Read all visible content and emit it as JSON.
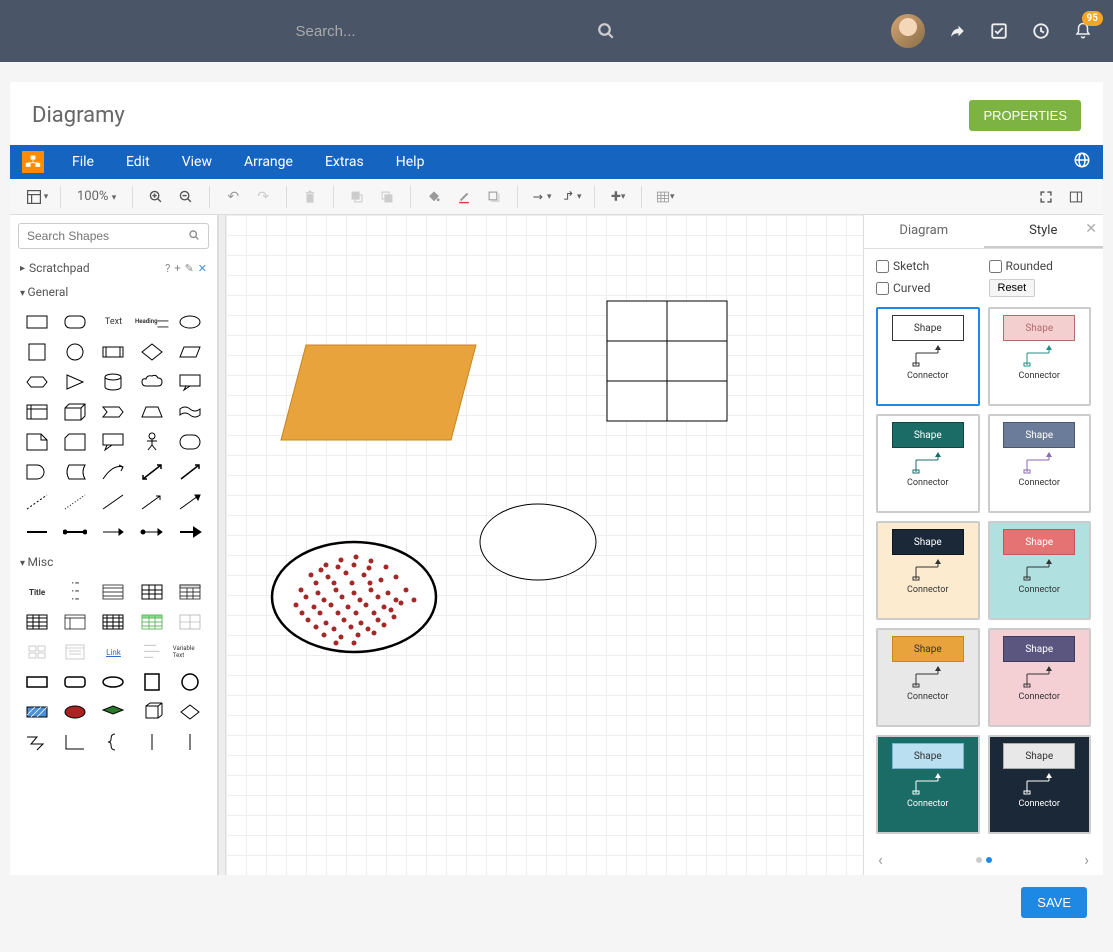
{
  "topbar": {
    "search_placeholder": "Search...",
    "badge": "95"
  },
  "app": {
    "title": "Diagramy",
    "properties_btn": "PROPERTIES",
    "save_btn": "SAVE"
  },
  "menu": {
    "file": "File",
    "edit": "Edit",
    "view": "View",
    "arrange": "Arrange",
    "extras": "Extras",
    "help": "Help"
  },
  "toolbar": {
    "zoom": "100%"
  },
  "left": {
    "search_placeholder": "Search Shapes",
    "scratchpad": "Scratchpad",
    "general": "General",
    "misc": "Misc",
    "text_cell": "Text",
    "title_cell": "Title",
    "link_cell": "Link",
    "variable_cell": "Variable Text",
    "heading_cell": "Heading"
  },
  "right": {
    "tab_diagram": "Diagram",
    "tab_style": "Style",
    "sketch": "Sketch",
    "curved": "Curved",
    "rounded": "Rounded",
    "reset": "Reset",
    "shape_label": "Shape",
    "connector_label": "Connector"
  },
  "style_cards": [
    {
      "bg": "#ffffff",
      "shape_fill": "#ffffff",
      "shape_border": "#333",
      "text": "#333",
      "conn": "#333",
      "border": "#1e88e5"
    },
    {
      "bg": "#ffffff",
      "shape_fill": "#f4cfcf",
      "shape_border": "#b56b6b",
      "text": "#b56b6b",
      "conn": "#2a8b8b",
      "border": "#ccc"
    },
    {
      "bg": "#ffffff",
      "shape_fill": "#1b6b67",
      "shape_border": "#0d4643",
      "text": "#fff",
      "conn": "#1b6b67",
      "border": "#ccc"
    },
    {
      "bg": "#ffffff",
      "shape_fill": "#6b7b9a",
      "shape_border": "#4a5670",
      "text": "#fff",
      "conn": "#8a6bb0",
      "border": "#ccc"
    },
    {
      "bg": "#fdebd0",
      "shape_fill": "#1b2838",
      "shape_border": "#0d1520",
      "text": "#fff",
      "conn": "#333",
      "border": "#ccc"
    },
    {
      "bg": "#b0e0e0",
      "shape_fill": "#e57373",
      "shape_border": "#c75555",
      "text": "#fff",
      "conn": "#333",
      "border": "#ccc"
    },
    {
      "bg": "#e8e8e8",
      "shape_fill": "#e8a33d",
      "shape_border": "#c7851f",
      "text": "#333",
      "conn": "#333",
      "border": "#ccc"
    },
    {
      "bg": "#f4d0d4",
      "shape_fill": "#5a5680",
      "shape_border": "#3d3a5c",
      "text": "#fff",
      "conn": "#333",
      "border": "#ccc"
    },
    {
      "bg": "#1b6b67",
      "shape_fill": "#b9dff0",
      "shape_border": "#7ab4d0",
      "text": "#333",
      "conn": "#fff",
      "border": "#ccc",
      "conn_text": "#fff"
    },
    {
      "bg": "#1b2838",
      "shape_fill": "#e8e8e8",
      "shape_border": "#aaa",
      "text": "#333",
      "conn": "#fff",
      "border": "#ccc",
      "conn_text": "#fff"
    }
  ]
}
